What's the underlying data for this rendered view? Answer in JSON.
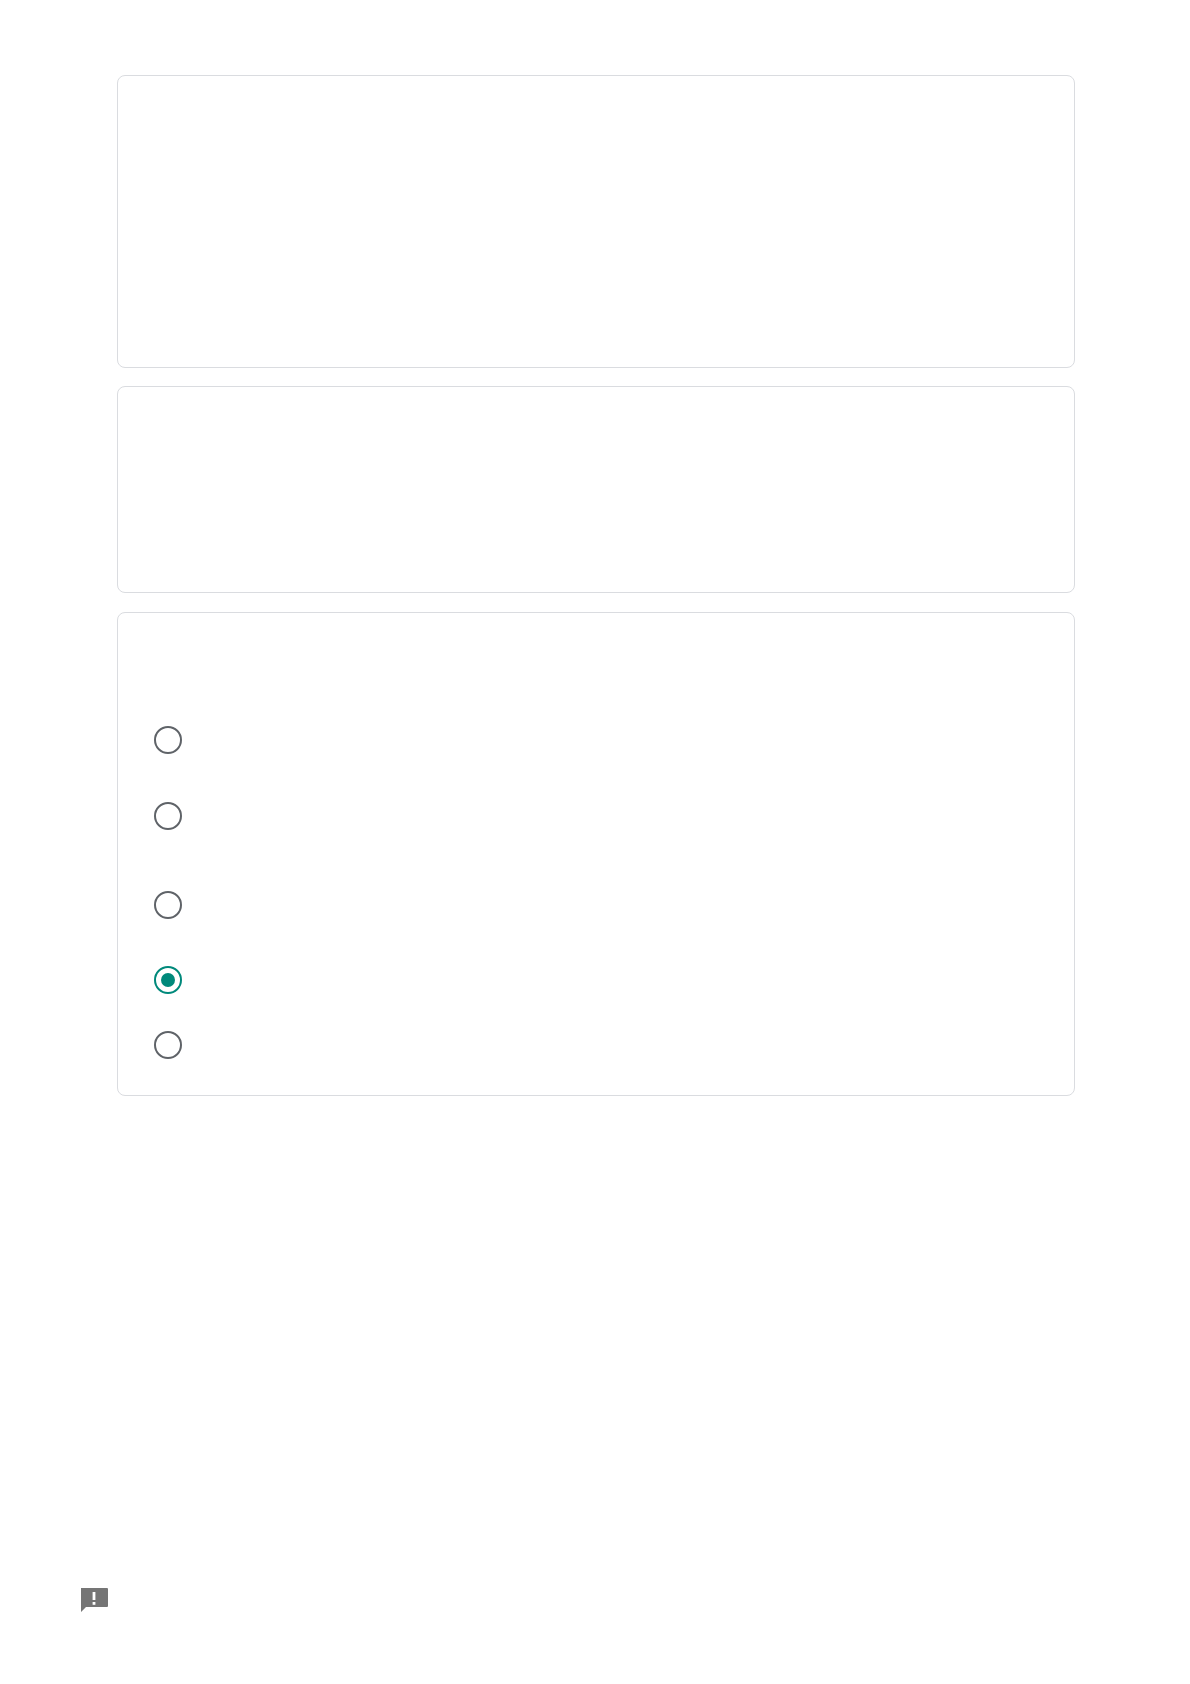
{
  "question": {
    "options": [
      {
        "selected": false
      },
      {
        "selected": false
      },
      {
        "selected": false
      },
      {
        "selected": true
      },
      {
        "selected": false
      }
    ]
  }
}
